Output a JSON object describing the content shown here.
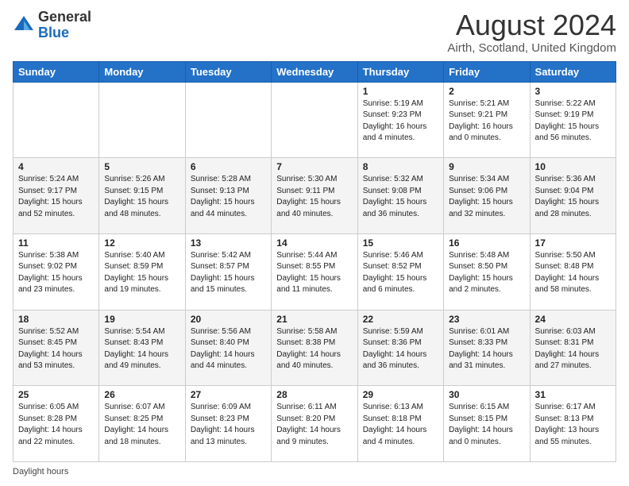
{
  "header": {
    "logo_general": "General",
    "logo_blue": "Blue",
    "month_year": "August 2024",
    "location": "Airth, Scotland, United Kingdom"
  },
  "footer": {
    "daylight_label": "Daylight hours"
  },
  "days_of_week": [
    "Sunday",
    "Monday",
    "Tuesday",
    "Wednesday",
    "Thursday",
    "Friday",
    "Saturday"
  ],
  "weeks": [
    [
      {
        "day": "",
        "info": ""
      },
      {
        "day": "",
        "info": ""
      },
      {
        "day": "",
        "info": ""
      },
      {
        "day": "",
        "info": ""
      },
      {
        "day": "1",
        "info": "Sunrise: 5:19 AM\nSunset: 9:23 PM\nDaylight: 16 hours\nand 4 minutes."
      },
      {
        "day": "2",
        "info": "Sunrise: 5:21 AM\nSunset: 9:21 PM\nDaylight: 16 hours\nand 0 minutes."
      },
      {
        "day": "3",
        "info": "Sunrise: 5:22 AM\nSunset: 9:19 PM\nDaylight: 15 hours\nand 56 minutes."
      }
    ],
    [
      {
        "day": "4",
        "info": "Sunrise: 5:24 AM\nSunset: 9:17 PM\nDaylight: 15 hours\nand 52 minutes."
      },
      {
        "day": "5",
        "info": "Sunrise: 5:26 AM\nSunset: 9:15 PM\nDaylight: 15 hours\nand 48 minutes."
      },
      {
        "day": "6",
        "info": "Sunrise: 5:28 AM\nSunset: 9:13 PM\nDaylight: 15 hours\nand 44 minutes."
      },
      {
        "day": "7",
        "info": "Sunrise: 5:30 AM\nSunset: 9:11 PM\nDaylight: 15 hours\nand 40 minutes."
      },
      {
        "day": "8",
        "info": "Sunrise: 5:32 AM\nSunset: 9:08 PM\nDaylight: 15 hours\nand 36 minutes."
      },
      {
        "day": "9",
        "info": "Sunrise: 5:34 AM\nSunset: 9:06 PM\nDaylight: 15 hours\nand 32 minutes."
      },
      {
        "day": "10",
        "info": "Sunrise: 5:36 AM\nSunset: 9:04 PM\nDaylight: 15 hours\nand 28 minutes."
      }
    ],
    [
      {
        "day": "11",
        "info": "Sunrise: 5:38 AM\nSunset: 9:02 PM\nDaylight: 15 hours\nand 23 minutes."
      },
      {
        "day": "12",
        "info": "Sunrise: 5:40 AM\nSunset: 8:59 PM\nDaylight: 15 hours\nand 19 minutes."
      },
      {
        "day": "13",
        "info": "Sunrise: 5:42 AM\nSunset: 8:57 PM\nDaylight: 15 hours\nand 15 minutes."
      },
      {
        "day": "14",
        "info": "Sunrise: 5:44 AM\nSunset: 8:55 PM\nDaylight: 15 hours\nand 11 minutes."
      },
      {
        "day": "15",
        "info": "Sunrise: 5:46 AM\nSunset: 8:52 PM\nDaylight: 15 hours\nand 6 minutes."
      },
      {
        "day": "16",
        "info": "Sunrise: 5:48 AM\nSunset: 8:50 PM\nDaylight: 15 hours\nand 2 minutes."
      },
      {
        "day": "17",
        "info": "Sunrise: 5:50 AM\nSunset: 8:48 PM\nDaylight: 14 hours\nand 58 minutes."
      }
    ],
    [
      {
        "day": "18",
        "info": "Sunrise: 5:52 AM\nSunset: 8:45 PM\nDaylight: 14 hours\nand 53 minutes."
      },
      {
        "day": "19",
        "info": "Sunrise: 5:54 AM\nSunset: 8:43 PM\nDaylight: 14 hours\nand 49 minutes."
      },
      {
        "day": "20",
        "info": "Sunrise: 5:56 AM\nSunset: 8:40 PM\nDaylight: 14 hours\nand 44 minutes."
      },
      {
        "day": "21",
        "info": "Sunrise: 5:58 AM\nSunset: 8:38 PM\nDaylight: 14 hours\nand 40 minutes."
      },
      {
        "day": "22",
        "info": "Sunrise: 5:59 AM\nSunset: 8:36 PM\nDaylight: 14 hours\nand 36 minutes."
      },
      {
        "day": "23",
        "info": "Sunrise: 6:01 AM\nSunset: 8:33 PM\nDaylight: 14 hours\nand 31 minutes."
      },
      {
        "day": "24",
        "info": "Sunrise: 6:03 AM\nSunset: 8:31 PM\nDaylight: 14 hours\nand 27 minutes."
      }
    ],
    [
      {
        "day": "25",
        "info": "Sunrise: 6:05 AM\nSunset: 8:28 PM\nDaylight: 14 hours\nand 22 minutes."
      },
      {
        "day": "26",
        "info": "Sunrise: 6:07 AM\nSunset: 8:25 PM\nDaylight: 14 hours\nand 18 minutes."
      },
      {
        "day": "27",
        "info": "Sunrise: 6:09 AM\nSunset: 8:23 PM\nDaylight: 14 hours\nand 13 minutes."
      },
      {
        "day": "28",
        "info": "Sunrise: 6:11 AM\nSunset: 8:20 PM\nDaylight: 14 hours\nand 9 minutes."
      },
      {
        "day": "29",
        "info": "Sunrise: 6:13 AM\nSunset: 8:18 PM\nDaylight: 14 hours\nand 4 minutes."
      },
      {
        "day": "30",
        "info": "Sunrise: 6:15 AM\nSunset: 8:15 PM\nDaylight: 14 hours\nand 0 minutes."
      },
      {
        "day": "31",
        "info": "Sunrise: 6:17 AM\nSunset: 8:13 PM\nDaylight: 13 hours\nand 55 minutes."
      }
    ]
  ]
}
